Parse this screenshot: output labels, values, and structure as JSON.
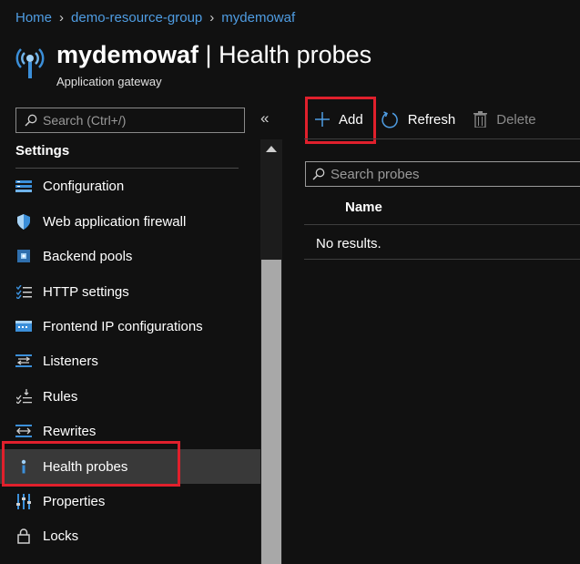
{
  "breadcrumb": [
    "Home",
    "demo-resource-group",
    "mydemowaf"
  ],
  "header": {
    "resource_name": "mydemowaf",
    "separator": " | ",
    "page": "Health probes",
    "subtitle": "Application gateway",
    "icon": "application-gateway-icon"
  },
  "sidebar": {
    "search_placeholder": "Search (Ctrl+/)",
    "collapse_glyph": "«",
    "section": "Settings",
    "items": [
      {
        "label": "Configuration",
        "icon": "configuration-icon"
      },
      {
        "label": "Web application firewall",
        "icon": "shield-icon"
      },
      {
        "label": "Backend pools",
        "icon": "backend-pools-icon"
      },
      {
        "label": "HTTP settings",
        "icon": "http-settings-icon"
      },
      {
        "label": "Frontend IP configurations",
        "icon": "frontend-ip-icon"
      },
      {
        "label": "Listeners",
        "icon": "listeners-icon"
      },
      {
        "label": "Rules",
        "icon": "rules-icon"
      },
      {
        "label": "Rewrites",
        "icon": "rewrites-icon"
      },
      {
        "label": "Health probes",
        "icon": "health-probe-icon",
        "active": true
      },
      {
        "label": "Properties",
        "icon": "properties-icon"
      },
      {
        "label": "Locks",
        "icon": "lock-icon"
      }
    ]
  },
  "toolbar": {
    "add_label": "Add",
    "refresh_label": "Refresh",
    "delete_label": "Delete"
  },
  "probes": {
    "search_placeholder": "Search probes",
    "column_name": "Name",
    "empty_text": "No results."
  },
  "colors": {
    "background": "#111111",
    "link": "#4f9de3",
    "highlight_box": "#e0202c",
    "active_item": "#393939",
    "icon_blue": "#3b8fd9"
  }
}
